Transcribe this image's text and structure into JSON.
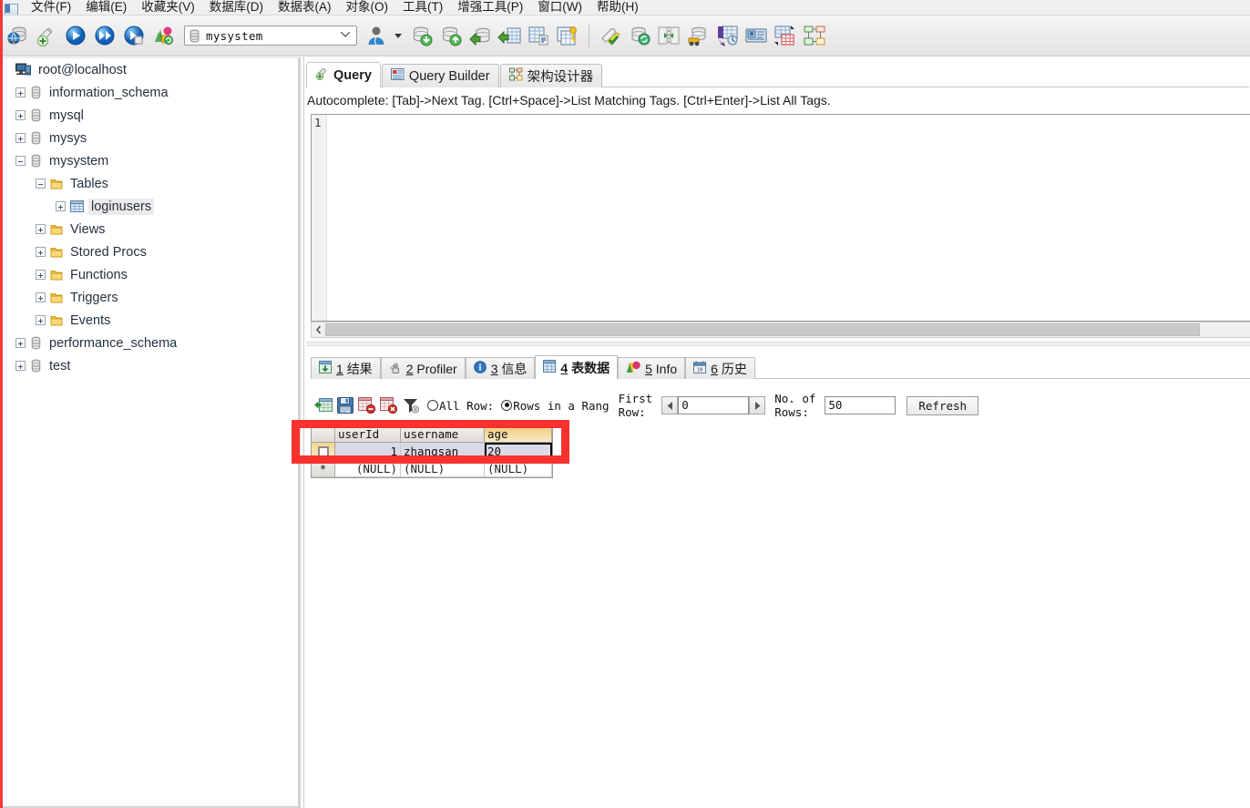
{
  "menu": {
    "app_icon": "window-icon",
    "items": [
      "文件(F)",
      "编辑(E)",
      "收藏夹(V)",
      "数据库(D)",
      "数据表(A)",
      "对象(O)",
      "工具(T)",
      "增强工具(P)",
      "窗口(W)",
      "帮助(H)"
    ]
  },
  "toolbar": {
    "buttons": [
      {
        "name": "connect-icon",
        "title": "连接"
      },
      {
        "name": "new-query-icon",
        "title": "新建查询"
      },
      {
        "name": "run-icon",
        "title": "运行"
      },
      {
        "name": "run-all-icon",
        "title": "运行全部"
      },
      {
        "name": "run-page-icon",
        "title": "运行当前页"
      },
      {
        "name": "refresh-objects-icon",
        "title": "刷新"
      }
    ],
    "db_selector": {
      "name": "database-combo",
      "value": "mysystem",
      "icon": "database-cylinder-icon",
      "chevron": "chevron-down-icon"
    },
    "user_button": {
      "name": "user-icon",
      "caret": "caret-down-icon"
    },
    "buttons2": [
      {
        "name": "backup-db-icon",
        "title": "备份数据库"
      },
      {
        "name": "restore-db-icon",
        "title": "还原数据库"
      },
      {
        "name": "import-db-icon",
        "title": "导入数据库"
      },
      {
        "name": "export-table-icon",
        "title": "导出数据表"
      },
      {
        "name": "table-report-icon",
        "title": "数据表报表"
      },
      {
        "name": "table-keys-icon",
        "title": "数据表权限"
      }
    ],
    "buttons3": [
      {
        "name": "paint-check-icon",
        "title": "应用"
      },
      {
        "name": "db-sync-icon",
        "title": "数据库同步"
      },
      {
        "name": "compare-icon",
        "title": "比较"
      },
      {
        "name": "data-transfer-icon",
        "title": "数据传输"
      },
      {
        "name": "db-to-chart-icon",
        "title": "数据转换"
      },
      {
        "name": "table-card-icon",
        "title": "卡片视图"
      },
      {
        "name": "grid-designer-icon",
        "title": "表格设计"
      },
      {
        "name": "er-diagram-icon",
        "title": "模型设计"
      }
    ]
  },
  "tree": {
    "root": {
      "label": "root@localhost",
      "icon": "server-icon",
      "level": 0,
      "expander": "none"
    },
    "nodes": [
      {
        "label": "information_schema",
        "icon": "database-icon",
        "level": 1,
        "expander": "plus"
      },
      {
        "label": "mysql",
        "icon": "database-icon",
        "level": 1,
        "expander": "plus"
      },
      {
        "label": "mysys",
        "icon": "database-icon",
        "level": 1,
        "expander": "plus"
      },
      {
        "label": "mysystem",
        "icon": "database-icon",
        "level": 1,
        "expander": "minus"
      },
      {
        "label": "Tables",
        "icon": "folder-icon",
        "level": 2,
        "expander": "minus"
      },
      {
        "label": "loginusers",
        "icon": "table-icon",
        "level": 3,
        "expander": "plus",
        "selected": true
      },
      {
        "label": "Views",
        "icon": "folder-icon",
        "level": 2,
        "expander": "plus"
      },
      {
        "label": "Stored Procs",
        "icon": "folder-icon",
        "level": 2,
        "expander": "plus"
      },
      {
        "label": "Functions",
        "icon": "folder-icon",
        "level": 2,
        "expander": "plus"
      },
      {
        "label": "Triggers",
        "icon": "folder-icon",
        "level": 2,
        "expander": "plus"
      },
      {
        "label": "Events",
        "icon": "folder-icon",
        "level": 2,
        "expander": "plus"
      },
      {
        "label": "performance_schema",
        "icon": "database-icon",
        "level": 1,
        "expander": "plus"
      },
      {
        "label": "test",
        "icon": "database-icon",
        "level": 1,
        "expander": "plus"
      }
    ]
  },
  "editor_tabs": [
    {
      "label": "Query",
      "icon": "query-icon",
      "active": true
    },
    {
      "label": "Query Builder",
      "icon": "query-builder-icon",
      "active": false
    },
    {
      "label": "架构设计器",
      "icon": "schema-designer-icon",
      "active": false
    }
  ],
  "autocomplete_hint": "Autocomplete: [Tab]->Next Tag. [Ctrl+Space]->List Matching Tags. [Ctrl+Enter]->List All Tags.",
  "editor": {
    "line_number": "1",
    "code": ""
  },
  "result_tabs": [
    {
      "num": "1",
      "label": "结果",
      "icon": "results-grid-icon",
      "active": false
    },
    {
      "num": "2",
      "label": "Profiler",
      "icon": "profiler-lock-icon",
      "active": false
    },
    {
      "num": "3",
      "label": "信息",
      "icon": "info-icon",
      "active": false
    },
    {
      "num": "4",
      "label": "表数据",
      "icon": "table-data-icon",
      "active": true
    },
    {
      "num": "5",
      "label": "Info",
      "icon": "chart-info-icon",
      "active": false
    },
    {
      "num": "6",
      "label": "历史",
      "icon": "calendar-icon",
      "active": false
    }
  ],
  "data_toolbar": {
    "icons": [
      {
        "name": "add-row-icon",
        "title": "添加记录"
      },
      {
        "name": "save-record-icon",
        "title": "保存记录"
      },
      {
        "name": "delete-row-icon",
        "title": "删除记录"
      },
      {
        "name": "cancel-row-icon",
        "title": "取消记录"
      },
      {
        "name": "filter-icon",
        "title": "筛选"
      }
    ],
    "radio_all_label": "All Row:",
    "radio_range_label": "Rows in a Rang",
    "radio_selected": "range",
    "first_row_label": "First\nRow:",
    "first_row_label_l1": "First",
    "first_row_label_l2": "Row:",
    "first_row_value": "0",
    "no_of_rows_label_l1": "No. of",
    "no_of_rows_label_l2": "Rows:",
    "no_of_rows_value": "50",
    "refresh_label": "Refresh",
    "prev_icon": "triangle-left-icon",
    "next_icon": "triangle-right-icon"
  },
  "data_grid": {
    "columns": [
      "userId",
      "username",
      "age"
    ],
    "selected_column": "age",
    "rows": [
      {
        "rowhdr": "checkbox",
        "selected": true,
        "cells": [
          "1",
          "zhangsan",
          "20"
        ],
        "selected_cell": 2
      },
      {
        "rowhdr": "*",
        "selected": false,
        "cells": [
          "(NULL)",
          "(NULL)",
          "(NULL)"
        ],
        "selected_cell": -1
      }
    ]
  },
  "annotation": {
    "name": "red-highlight-box",
    "color": "#f7322f"
  }
}
